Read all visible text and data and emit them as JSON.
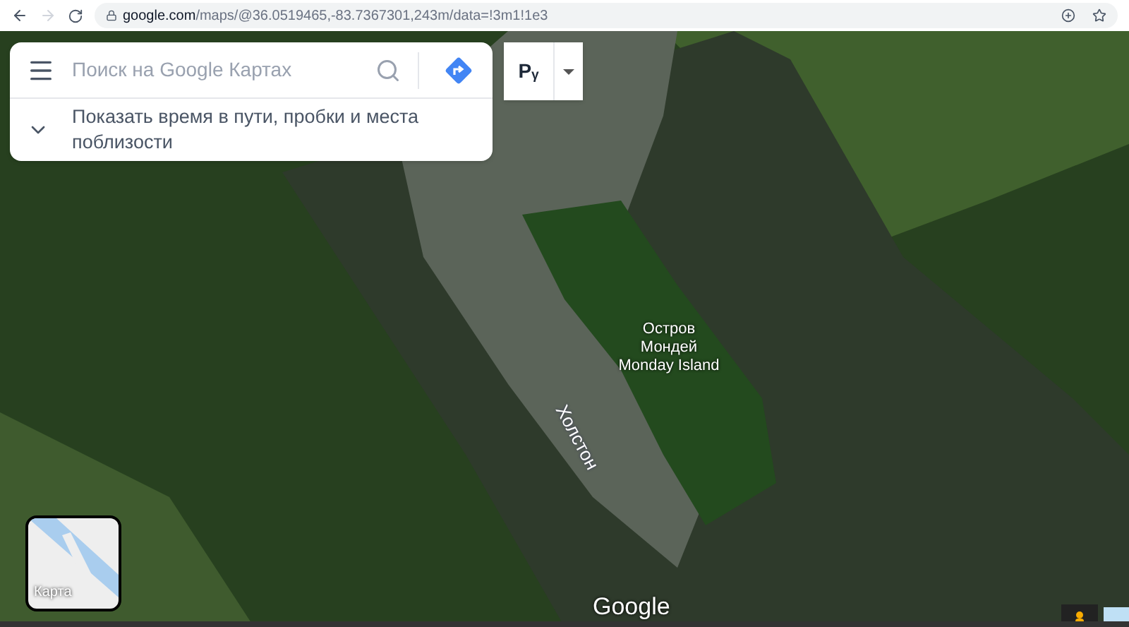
{
  "browser": {
    "url_host": "google.com",
    "url_path": "/maps/@36.0519465,-83.7367301,243m/data=!3m1!1e3"
  },
  "search": {
    "placeholder": "Поиск на Google Картах"
  },
  "suggestion": {
    "text": "Показать время в пути, пробки и места поблизости"
  },
  "label_toggle": {
    "text": "Pᵧ"
  },
  "map_labels": [
    {
      "kind": "place",
      "lines": [
        "Остров",
        "Мондей",
        "Monday Island"
      ]
    },
    {
      "kind": "river",
      "lines": [
        "Холстон"
      ]
    }
  ],
  "layer_switch": {
    "label": "Карта"
  },
  "logo": "Google"
}
